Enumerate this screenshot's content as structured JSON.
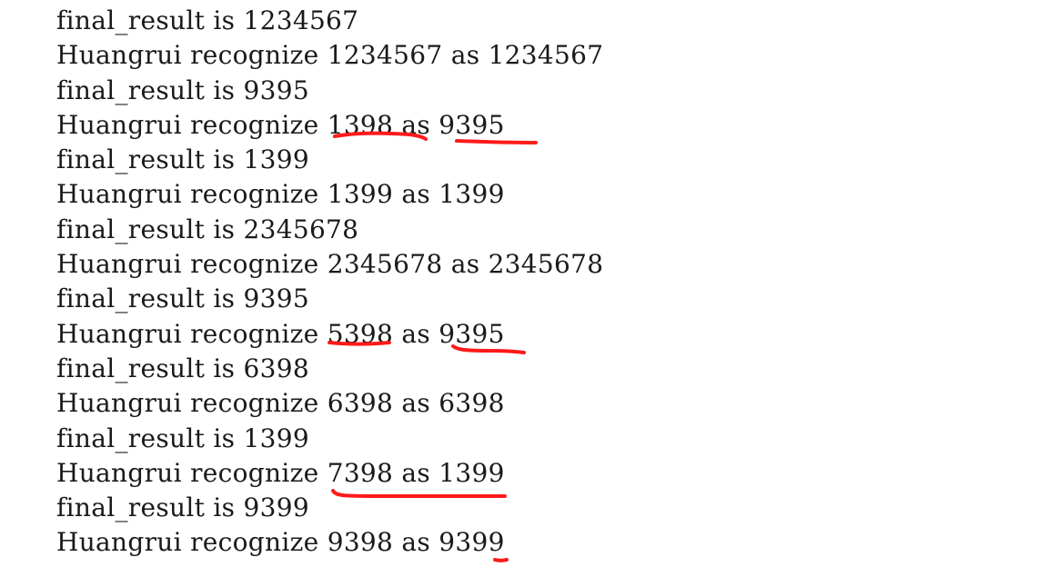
{
  "console": {
    "lines": [
      "final_result is 1234567",
      "Huangrui recognize 1234567 as 1234567",
      "final_result is 9395",
      "Huangrui recognize 1398 as 9395",
      "final_result is 1399",
      "Huangrui recognize 1399 as 1399",
      "final_result is 2345678",
      "Huangrui recognize 2345678 as 2345678",
      "final_result is 9395",
      "Huangrui recognize 5398 as 9395",
      "final_result is 6398",
      "Huangrui recognize 6398 as 6398",
      "final_result is 1399",
      "Huangrui recognize 7398 as 1399",
      "final_result is 9399",
      "Huangrui recognize 9398 as 9399"
    ]
  },
  "annotation_color": "#ff1a1a"
}
